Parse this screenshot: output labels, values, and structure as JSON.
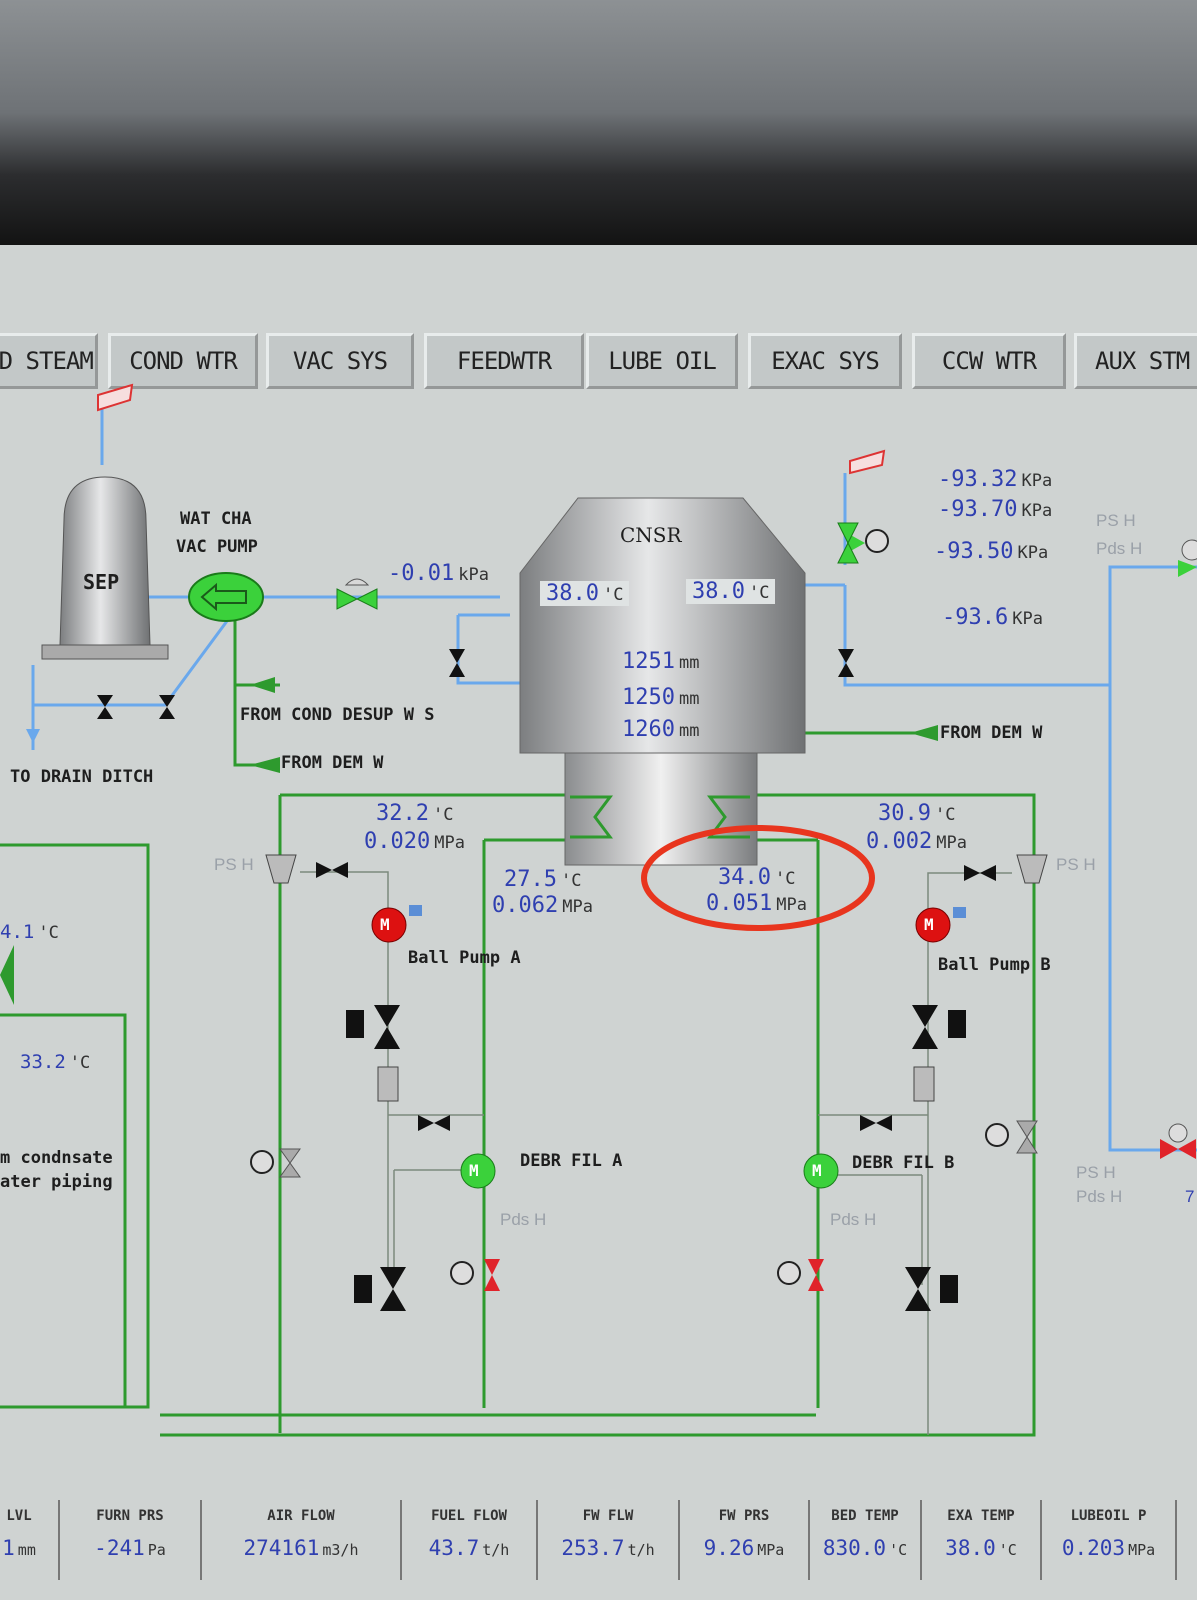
{
  "tabs": [
    "ND STEAM",
    "COND WTR",
    "VAC SYS",
    "FEEDWTR",
    "LUBE OIL",
    "EXAC SYS",
    "CCW WTR",
    "AUX STM H"
  ],
  "labels": {
    "sep": "SEP",
    "wat_cha": "WAT CHA",
    "vac_pump": "VAC PUMP",
    "cnsr": "CNSR",
    "from_cond_desup": "FROM COND DESUP W S",
    "from_dem_w_left": "FROM DEM W",
    "from_dem_w_right": "FROM DEM W",
    "to_drain_ditch": "TO DRAIN DITCH",
    "ball_pump_a": "Ball Pump A",
    "ball_pump_b": "Ball Pump B",
    "debr_fil_a": "DEBR FIL A",
    "debr_fil_b": "DEBR FIL B",
    "condensate_1": "m condnsate",
    "condensate_2": "ater piping",
    "ps_h_left": "PS H",
    "ps_h_right": "PS H",
    "ps_h_top": "PS H",
    "pds_h_top": "Pds H",
    "pds_h_a": "Pds H",
    "pds_h_b": "Pds H",
    "ps_h_far": "PS H",
    "pds_h_far": "Pds H",
    "edge_seven": "7",
    "motor": "M"
  },
  "readings": {
    "vac_line": {
      "value": "-0.01",
      "unit": "kPa"
    },
    "cnsr_temp_left": {
      "value": "38.0",
      "unit": "'C"
    },
    "cnsr_temp_right": {
      "value": "38.0",
      "unit": "'C"
    },
    "level_1": {
      "value": "1251",
      "unit": "mm"
    },
    "level_2": {
      "value": "1250",
      "unit": "mm"
    },
    "level_3": {
      "value": "1260",
      "unit": "mm"
    },
    "press_1": {
      "value": "-93.32",
      "unit": "KPa"
    },
    "press_2": {
      "value": "-93.70",
      "unit": "KPa"
    },
    "press_3": {
      "value": "-93.50",
      "unit": "KPa"
    },
    "press_4": {
      "value": "-93.6",
      "unit": "KPa"
    },
    "in_a_temp": {
      "value": "32.2",
      "unit": "'C"
    },
    "in_a_press": {
      "value": "0.020",
      "unit": "MPa"
    },
    "out_a_temp": {
      "value": "27.5",
      "unit": "'C"
    },
    "out_a_press": {
      "value": "0.062",
      "unit": "MPa"
    },
    "out_b_temp": {
      "value": "34.0",
      "unit": "'C"
    },
    "out_b_press": {
      "value": "0.051",
      "unit": "MPa"
    },
    "in_b_temp": {
      "value": "30.9",
      "unit": "'C"
    },
    "in_b_press": {
      "value": "0.002",
      "unit": "MPa"
    },
    "left_temp_1": {
      "value": "4.1",
      "unit": "'C"
    },
    "left_temp_2": {
      "value": "33.2",
      "unit": "'C"
    }
  },
  "status_bar": [
    {
      "title": "LVL",
      "value": "1",
      "unit": "mm"
    },
    {
      "title": "FURN PRS",
      "value": "-241",
      "unit": "Pa"
    },
    {
      "title": "AIR FLOW",
      "value": "274161",
      "unit": "m3/h"
    },
    {
      "title": "FUEL FLOW",
      "value": "43.7",
      "unit": "t/h"
    },
    {
      "title": "FW FLW",
      "value": "253.7",
      "unit": "t/h"
    },
    {
      "title": "FW PRS",
      "value": "9.26",
      "unit": "MPa"
    },
    {
      "title": "BED TEMP",
      "value": "830.0",
      "unit": "'C"
    },
    {
      "title": "EXA TEMP",
      "value": "38.0",
      "unit": "'C"
    },
    {
      "title": "LUBEOIL P",
      "value": "0.203",
      "unit": "MPa"
    }
  ],
  "colors": {
    "pipe_water": "#6aa8ec",
    "pipe_green": "#2e9a2e",
    "value_text": "#2f3fb0",
    "highlight": "#e8351e",
    "motor_red": "#d11",
    "motor_green": "#3bd13b"
  }
}
